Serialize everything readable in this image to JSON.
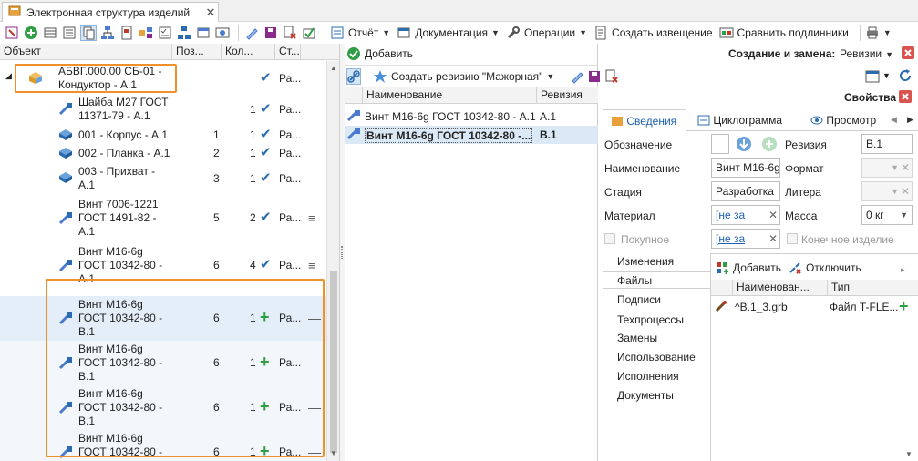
{
  "tab": {
    "title": "Электронная структура изделий",
    "close": "✕"
  },
  "toolbar": {
    "report": "Отчёт",
    "docs": "Документация",
    "ops": "Операции",
    "notice": "Создать извещение",
    "compare": "Сравнить подлинники"
  },
  "tree": {
    "columns": {
      "object": "Объект",
      "pos": "Поз...",
      "qty": "Кол...",
      "status": "Ст..."
    },
    "rows": [
      {
        "l1": "АБВГ.000.00 СБ-01 -",
        "l2": "Кондуктор - А.1",
        "l3": "",
        "pos": "",
        "qty": "",
        "st": "Ра..."
      },
      {
        "l1": "Шайба М27 ГОСТ",
        "l2": "11371-79 - А.1",
        "l3": "",
        "pos": "",
        "qty": "1",
        "st": "Ра..."
      },
      {
        "l1": "001 - Корпус - А.1",
        "l2": "",
        "l3": "",
        "pos": "1",
        "qty": "1",
        "st": "Ра..."
      },
      {
        "l1": "002 - Планка - А.1",
        "l2": "",
        "l3": "",
        "pos": "2",
        "qty": "1",
        "st": "Ра..."
      },
      {
        "l1": "003 - Прихват -",
        "l2": "А.1",
        "l3": "",
        "pos": "3",
        "qty": "1",
        "st": "Ра..."
      },
      {
        "l1": "Винт 7006-1221",
        "l2": "ГОСТ 1491-82 -",
        "l3": "А.1",
        "pos": "5",
        "qty": "2",
        "st": "Ра..."
      },
      {
        "l1": "Винт М16-6g",
        "l2": "ГОСТ 10342-80 -",
        "l3": "А.1",
        "pos": "6",
        "qty": "4",
        "st": "Ра..."
      },
      {
        "l1": "Винт М16-6g",
        "l2": "ГОСТ 10342-80 -",
        "l3": "В.1",
        "pos": "6",
        "qty": "1",
        "st": "Ра..."
      },
      {
        "l1": "Винт М16-6g",
        "l2": "ГОСТ 10342-80 -",
        "l3": "В.1",
        "pos": "6",
        "qty": "1",
        "st": "Ра..."
      },
      {
        "l1": "Винт М16-6g",
        "l2": "ГОСТ 10342-80 -",
        "l3": "В.1",
        "pos": "6",
        "qty": "1",
        "st": "Ра..."
      },
      {
        "l1": "Винт М16-6g",
        "l2": "ГОСТ 10342-80 -",
        "l3": "В.1",
        "pos": "6",
        "qty": "1",
        "st": "Ра..."
      }
    ]
  },
  "middle": {
    "add": "Добавить",
    "create_rev": "Создать ревизию \"Мажорная\"",
    "columns": {
      "name": "Наименование",
      "rev": "Ревизия"
    },
    "rows": [
      {
        "name": "Винт М16-6g ГОСТ 10342-80 - А.1",
        "rev": "А.1"
      },
      {
        "name": "Винт М16-6g ГОСТ 10342-80 -...",
        "rev": "В.1"
      }
    ]
  },
  "right": {
    "title": "Создание и замена:",
    "mode": "Ревизии",
    "props": "Свойства",
    "tabs": [
      "Сведения",
      "Циклограмма",
      "Просмотр"
    ],
    "labels": {
      "designation": "Обозначение",
      "name": "Наименование",
      "stage": "Стадия",
      "material": "Материал",
      "purchased": "Покупное",
      "revision": "Ревизия",
      "format": "Формат",
      "litera": "Литера",
      "mass": "Масса",
      "final": "Конечное изделие"
    },
    "values": {
      "name": "Винт М16-6g",
      "stage": "Разработка",
      "material": "[не за",
      "purchased": "[не за",
      "revision": "В.1",
      "mass": "0 кг"
    },
    "side_tabs": [
      "Изменения",
      "Файлы",
      "Подписи",
      "Техпроцессы",
      "Замены",
      "Использование",
      "Исполнения",
      "Документы"
    ],
    "files": {
      "add": "Добавить",
      "detach": "Отключить",
      "columns": {
        "name": "Наименован...",
        "type": "Тип"
      },
      "rows": [
        {
          "name": "^B.1_3.grb",
          "type": "Файл T-FLE..."
        }
      ]
    }
  },
  "colors": {
    "accent": "#2b6cb0",
    "highlight": "#f0902a",
    "add_green": "#2f9e44",
    "selection": "#dbe9f7"
  }
}
